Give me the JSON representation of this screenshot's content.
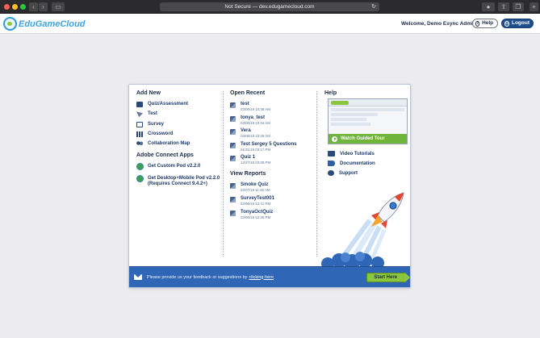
{
  "browser": {
    "address": "Not Secure — dev.edugamecloud.com",
    "nav_back": "‹",
    "nav_forward": "›",
    "new_tab": "+"
  },
  "header": {
    "logo_text": "EduGameCloud",
    "welcome": "Welcome, Demo Esync Admin",
    "help_label": "Help",
    "logout_label": "Logout"
  },
  "add_new": {
    "title": "Add New",
    "items": [
      {
        "label": "Quiz/Assessment",
        "icon": "quiz-icon"
      },
      {
        "label": "Test",
        "icon": "test-icon"
      },
      {
        "label": "Survey",
        "icon": "survey-icon"
      },
      {
        "label": "Crossword",
        "icon": "crossword-icon"
      },
      {
        "label": "Collaboration Map",
        "icon": "collaboration-map-icon"
      }
    ]
  },
  "adobe_connect": {
    "title": "Adobe Connect Apps",
    "items": [
      {
        "label": "Get Custom Pod v2.2.0"
      },
      {
        "label": "Get Desktop+Mobile Pod v2.2.0 (Requires Connect 9.4.2+)"
      }
    ]
  },
  "open_recent": {
    "title": "Open Recent",
    "items": [
      {
        "name": "test",
        "date": "03/06/19 10:38 AM"
      },
      {
        "name": "tonya_test",
        "date": "03/06/19 10:34 AM"
      },
      {
        "name": "Vera",
        "date": "03/06/19 10:29 AM"
      },
      {
        "name": "Test Sergey 5 Questions",
        "date": "01/31/19 03:17 PM"
      },
      {
        "name": "Quiz 1",
        "date": "12/27/18 03:35 PM"
      }
    ]
  },
  "view_reports": {
    "title": "View Reports",
    "items": [
      {
        "name": "Smoke Quiz",
        "date": "02/07/19 11:49 AM"
      },
      {
        "name": "SurveyTest001",
        "date": "02/06/19 12:41 PM"
      },
      {
        "name": "TonyaOctQuiz",
        "date": "02/06/19 12:35 PM"
      }
    ]
  },
  "help": {
    "title": "Help",
    "tour_label": "Watch Guided Tour",
    "items": [
      {
        "label": "Video Tutorials",
        "icon": "video-icon"
      },
      {
        "label": "Documentation",
        "icon": "book-icon"
      },
      {
        "label": "Support",
        "icon": "support-icon"
      }
    ]
  },
  "footer": {
    "text": "Please provide us your feedback or suggestions by",
    "link": "clicking here",
    "start_label": "Start Here"
  },
  "colors": {
    "brand_blue": "#2f66b5",
    "brand_green": "#8cc63f",
    "text_navy": "#1d3a6b"
  }
}
